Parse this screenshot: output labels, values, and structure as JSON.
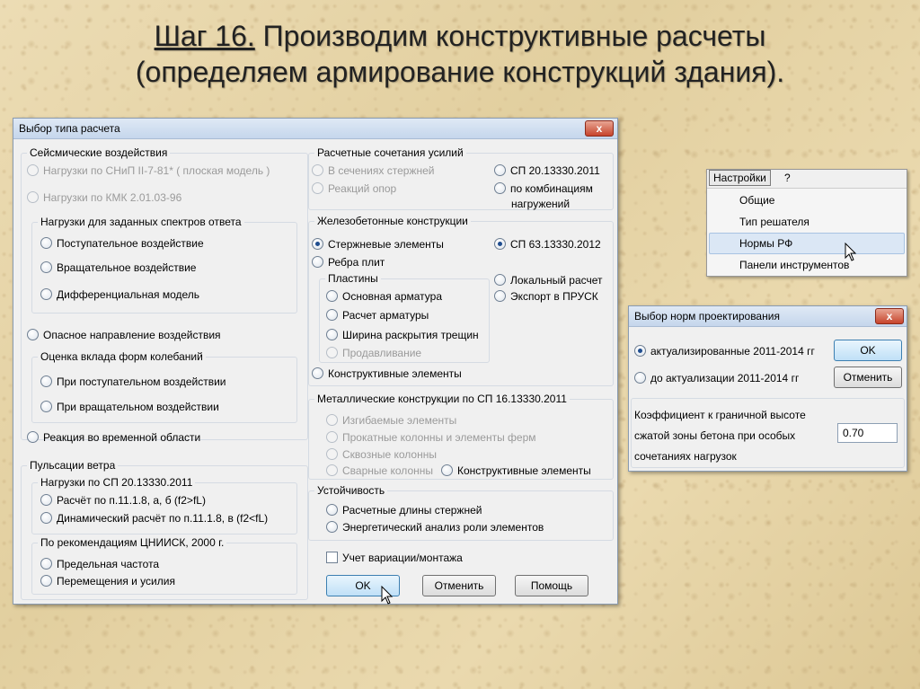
{
  "slide": {
    "title_step": "Шаг 16.",
    "title_rest": " Производим конструктивные расчеты",
    "title_line2": "(определяем армирование конструкций здания)."
  },
  "dlg1": {
    "title": "Выбор типа расчета",
    "close": "x",
    "seismic": {
      "legend": "Сейсмические воздействия",
      "opt1": "Нагрузки  по СНиП II-7-81* ( плоская модель )",
      "opt2": "Нагрузки по КМК 2.01.03-96"
    },
    "spectra": {
      "legend": "Нагрузки для заданных спектров ответа",
      "opt1": "Поступательное воздействие",
      "opt2": "Вращательное воздействие",
      "opt3": "Дифференциальная модель"
    },
    "danger": "Опасное направление воздействия",
    "modes": {
      "legend": "Оценка вклада форм колебаний",
      "opt1": "При поступательном воздействии",
      "opt2": "При вращательном воздействии"
    },
    "reaction": "Реакция во временной области",
    "wind": {
      "legend": "Пульсации ветра",
      "sp_legend": "Нагрузки по СП 20.13330.2011",
      "sp_opt1": "Расчёт по п.11.1.8, а, б (f2>fL)",
      "sp_opt2": "Динамический расчёт по п.11.1.8, в (f2<fL)",
      "rec_legend": "По рекомендациям ЦНИИСК, 2000 г.",
      "rec_opt1": "Предельная частота",
      "rec_opt2": "Перемещения и усилия"
    },
    "combos": {
      "legend": "Расчетные сочетания усилий",
      "opt1": "В сечениях стержней",
      "opt2": "Реакций опор",
      "opt3": "СП 20.13330.2011",
      "opt4a": "по комбинациям",
      "opt4b": "нагружений"
    },
    "rc": {
      "legend": "Железобетонные конструкции",
      "opt1": "Стержневые элементы",
      "opt2": "Ребра плит",
      "norm": "СП 63.13330.2012",
      "local": "Локальный расчет",
      "export": "Экспорт в ПРУСК",
      "plates_legend": "Пластины",
      "p1": "Основная арматура",
      "p2": "Расчет арматуры",
      "p3": "Ширина раскрытия трещин",
      "p4": "Продавливание",
      "constr": "Конструктивные элементы"
    },
    "steel": {
      "legend": "Металлические конструкции по СП 16.13330.2011",
      "opt1": "Изгибаемые элементы",
      "opt2": "Прокатные колонны и элементы ферм",
      "opt3": "Сквозные колонны",
      "opt4": "Сварные колонны",
      "opt5": "Конструктивные элементы"
    },
    "stab": {
      "legend": "Устойчивость",
      "opt1": "Расчетные длины стержней",
      "opt2": "Энергетический анализ роли элементов"
    },
    "variation": "Учет вариации/монтажа",
    "ok": "OK",
    "cancel": "Отменить",
    "help": "Помощь"
  },
  "menu": {
    "bar_settings": "Настройки",
    "bar_help": "?",
    "items": [
      "Общие",
      "Тип решателя",
      "Нормы РФ",
      "Панели инструментов"
    ]
  },
  "dlg2": {
    "title": "Выбор норм проектирования",
    "close": "x",
    "opt1": "актуализированные 2011-2014 гг",
    "opt2": "до актуализации 2011-2014 гг",
    "ok": "OK",
    "cancel": "Отменить",
    "coef1": "Коэффициент к граничной высоте",
    "coef2": "сжатой зоны бетона при особых",
    "coef3": "сочетаниях нагрузок",
    "value": "0.70"
  },
  "colors": {
    "accent_ok": "#bfe0f7",
    "close_red": "#c7442c"
  }
}
